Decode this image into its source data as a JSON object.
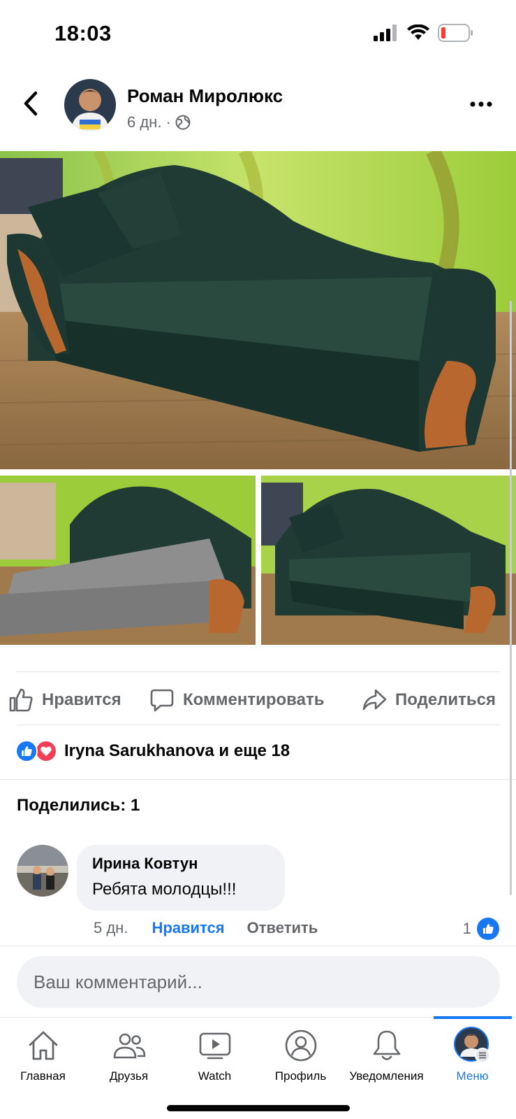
{
  "status": {
    "time": "18:03"
  },
  "post": {
    "author": "Роман Миролюкс",
    "age": "6 дн.",
    "separator": "·"
  },
  "actions": {
    "like": "Нравится",
    "comment": "Комментировать",
    "share": "Поделиться"
  },
  "reactions": {
    "text": "Iryna Sarukhanova и еще 18"
  },
  "shares": "Поделились: 1",
  "comment": {
    "author": "Ирина Ковтун",
    "text": "Ребята молодцы!!!",
    "age": "5 дн.",
    "like": "Нравится",
    "reply": "Ответить",
    "like_count": "1"
  },
  "composer": {
    "placeholder": "Ваш комментарий..."
  },
  "nav": {
    "home": "Главная",
    "friends": "Друзья",
    "watch": "Watch",
    "profile": "Профиль",
    "notifications": "Уведомления",
    "menu": "Меню"
  },
  "colors": {
    "accent": "#1877f2",
    "love": "#f33e58",
    "secondary_text": "#65676b"
  }
}
